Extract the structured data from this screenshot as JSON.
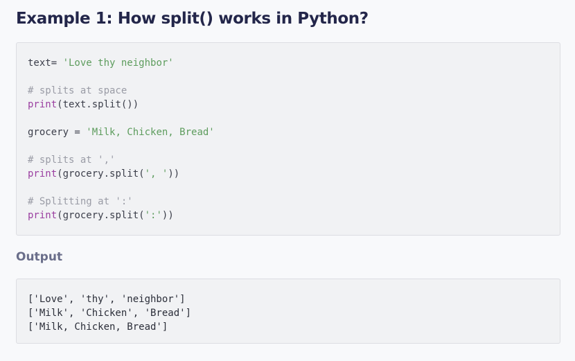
{
  "heading": "Example 1: How split() works in Python?",
  "code_lines": [
    [
      {
        "t": "text= ",
        "c": "plain"
      },
      {
        "t": "'Love thy neighbor'",
        "c": "str"
      }
    ],
    [],
    [
      {
        "t": "# splits at space",
        "c": "com"
      }
    ],
    [
      {
        "t": "print",
        "c": "fn"
      },
      {
        "t": "(text.split())",
        "c": "plain"
      }
    ],
    [],
    [
      {
        "t": "grocery = ",
        "c": "plain"
      },
      {
        "t": "'Milk, Chicken, Bread'",
        "c": "str"
      }
    ],
    [],
    [
      {
        "t": "# splits at ','",
        "c": "com"
      }
    ],
    [
      {
        "t": "print",
        "c": "fn"
      },
      {
        "t": "(grocery.split(",
        "c": "plain"
      },
      {
        "t": "', '",
        "c": "str"
      },
      {
        "t": "))",
        "c": "plain"
      }
    ],
    [],
    [
      {
        "t": "# Splitting at ':'",
        "c": "com"
      }
    ],
    [
      {
        "t": "print",
        "c": "fn"
      },
      {
        "t": "(grocery.split(",
        "c": "plain"
      },
      {
        "t": "':'",
        "c": "str"
      },
      {
        "t": "))",
        "c": "plain"
      }
    ]
  ],
  "output_label": "Output",
  "output_lines": [
    "['Love', 'thy', 'neighbor']",
    "['Milk', 'Chicken', 'Bread']",
    "['Milk, Chicken, Bread']"
  ]
}
